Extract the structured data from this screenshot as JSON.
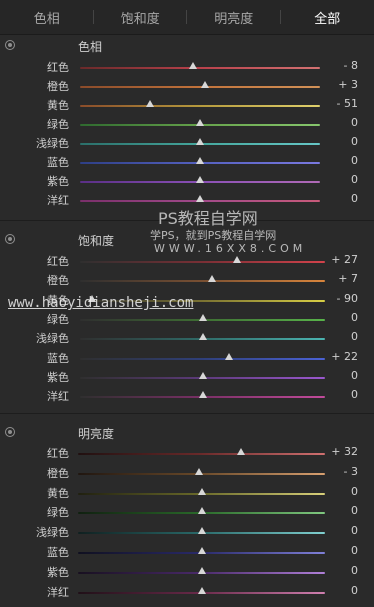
{
  "tabs": [
    "色相",
    "饱和度",
    "明亮度",
    "全部"
  ],
  "active_tab": 3,
  "sections": [
    {
      "title": "色相",
      "rows": [
        {
          "label": "红色",
          "value": "- 8",
          "level": 0.47,
          "grad": [
            "#6a2a2a",
            "#b9414b",
            "#d37272"
          ]
        },
        {
          "label": "橙色",
          "value": "+ 3",
          "level": 0.52,
          "grad": [
            "#8a4b2a",
            "#c2733b",
            "#d29258"
          ]
        },
        {
          "label": "黄色",
          "value": "- 51",
          "level": 0.29,
          "grad": [
            "#8a4c2a",
            "#b59a3d",
            "#dfd06c"
          ]
        },
        {
          "label": "绿色",
          "value": "0",
          "level": 0.5,
          "grad": [
            "#2f6a2f",
            "#66a24b",
            "#87c66d"
          ]
        },
        {
          "label": "浅绿色",
          "value": "0",
          "level": 0.5,
          "grad": [
            "#2b6f6a",
            "#45a79d",
            "#67c7c7"
          ]
        },
        {
          "label": "蓝色",
          "value": "0",
          "level": 0.5,
          "grad": [
            "#2e3f86",
            "#5561c0",
            "#7a79e0"
          ]
        },
        {
          "label": "紫色",
          "value": "0",
          "level": 0.5,
          "grad": [
            "#5a2f86",
            "#8a50b6",
            "#b06ab6"
          ]
        },
        {
          "label": "洋红",
          "value": "0",
          "level": 0.5,
          "grad": [
            "#7a2f6a",
            "#a14a8a",
            "#c85a7a"
          ]
        }
      ]
    },
    {
      "title": "饱和度",
      "rows": [
        {
          "label": "红色",
          "value": "+ 27",
          "level": 0.64,
          "grad": [
            "#2f2f2f",
            "#7a2f35",
            "#d2424b"
          ]
        },
        {
          "label": "橙色",
          "value": "+ 7",
          "level": 0.54,
          "grad": [
            "#2f2f2f",
            "#7a5032",
            "#d9853c"
          ]
        },
        {
          "label": "黄色",
          "value": "- 90",
          "level": 0.05,
          "grad": [
            "#2f2f2f",
            "#7a7232",
            "#d8cf45"
          ]
        },
        {
          "label": "绿色",
          "value": "0",
          "level": 0.5,
          "grad": [
            "#2f2f2f",
            "#3e6e33",
            "#58b34a"
          ]
        },
        {
          "label": "浅绿色",
          "value": "0",
          "level": 0.5,
          "grad": [
            "#2f2f2f",
            "#2f6b68",
            "#4bb5b1"
          ]
        },
        {
          "label": "蓝色",
          "value": "+ 22",
          "level": 0.61,
          "grad": [
            "#2f2f2f",
            "#2f3f7a",
            "#4b62d6"
          ]
        },
        {
          "label": "紫色",
          "value": "0",
          "level": 0.5,
          "grad": [
            "#2f2f2f",
            "#5c3a7a",
            "#9a58cf"
          ]
        },
        {
          "label": "洋红",
          "value": "0",
          "level": 0.5,
          "grad": [
            "#2f2f2f",
            "#7a2f66",
            "#c24b9b"
          ]
        }
      ]
    },
    {
      "title": "明亮度",
      "rows": [
        {
          "label": "红色",
          "value": "+ 32",
          "level": 0.66,
          "grad": [
            "#201010",
            "#6a2a2a",
            "#d07070"
          ]
        },
        {
          "label": "橙色",
          "value": "- 3",
          "level": 0.49,
          "grad": [
            "#201610",
            "#6a4a2a",
            "#d8a070"
          ]
        },
        {
          "label": "黄色",
          "value": "0",
          "level": 0.5,
          "grad": [
            "#202010",
            "#6a6a2a",
            "#d8d07a"
          ]
        },
        {
          "label": "绿色",
          "value": "0",
          "level": 0.5,
          "grad": [
            "#102010",
            "#2a6a2a",
            "#80c880"
          ]
        },
        {
          "label": "浅绿色",
          "value": "0",
          "level": 0.5,
          "grad": [
            "#102020",
            "#2a6a6a",
            "#80d0d0"
          ]
        },
        {
          "label": "蓝色",
          "value": "0",
          "level": 0.5,
          "grad": [
            "#101020",
            "#2a2a6a",
            "#8080d8"
          ]
        },
        {
          "label": "紫色",
          "value": "0",
          "level": 0.5,
          "grad": [
            "#181020",
            "#4a2a6a",
            "#b080d8"
          ]
        },
        {
          "label": "洋红",
          "value": "0",
          "level": 0.5,
          "grad": [
            "#201018",
            "#6a2a4a",
            "#d080b0"
          ]
        }
      ]
    }
  ],
  "watermarks": [
    "PS教程自学网",
    "学PS，就到PS教程自学网",
    "WWW.16XX8.COM",
    "www.haoyidiansheji.com"
  ]
}
